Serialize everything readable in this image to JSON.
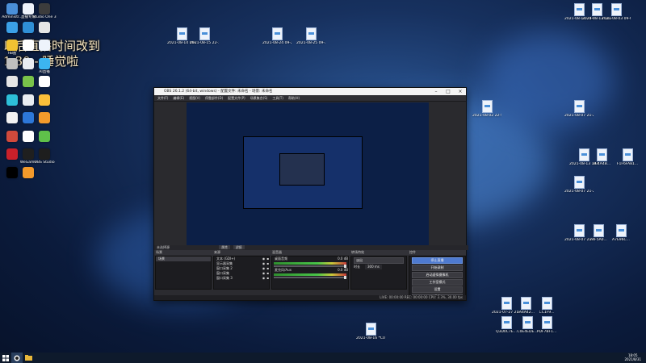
{
  "overlay": {
    "line1": "以后直播时间改到",
    "line2": "1:30 - 睡觉啦"
  },
  "desktop_icons_left": [
    {
      "label": "Administr...",
      "color": "#4a8fd8"
    },
    {
      "label": "直播专用",
      "color": "#eef3fb"
    },
    {
      "label": "Studio One 3",
      "color": "#3c3c3c"
    },
    {
      "label": "",
      "color": "#3ba0e6"
    },
    {
      "label": "",
      "color": "#2f8fd6"
    },
    {
      "label": "",
      "color": "#e6e6e6"
    },
    {
      "label": "HB图",
      "color": "#f1c232"
    },
    {
      "label": "",
      "color": "#ffffff"
    },
    {
      "label": "",
      "color": "#eef3fb"
    },
    {
      "label": "",
      "color": "#bfbfbf"
    },
    {
      "label": "",
      "color": "#e8ecf2"
    },
    {
      "label": "AI直播",
      "color": "#3cb4f0"
    },
    {
      "label": "",
      "color": "#e6e6e6"
    },
    {
      "label": "",
      "color": "#79c34a"
    },
    {
      "label": "",
      "color": "#ffffff"
    },
    {
      "label": "",
      "color": "#2dbfd8"
    },
    {
      "label": "",
      "color": "#e8ecf2"
    },
    {
      "label": "",
      "color": "#fbbf3a"
    },
    {
      "label": "",
      "color": "#f2f2f2"
    },
    {
      "label": "",
      "color": "#2d77d8"
    },
    {
      "label": "",
      "color": "#f39a2b"
    },
    {
      "label": "",
      "color": "#d14a3c"
    },
    {
      "label": "",
      "color": "#ffffff"
    },
    {
      "label": "",
      "color": "#5fc14a"
    },
    {
      "label": "",
      "color": "#c8202a"
    },
    {
      "label": "WeGame",
      "color": "#1f1f1f"
    },
    {
      "label": "OBS Studio",
      "color": "#1e1e1e"
    },
    {
      "label": "",
      "color": "#000000"
    },
    {
      "label": "",
      "color": "#f39a2b"
    }
  ],
  "desktop_icons_right": [
    {
      "label": "2021-08-13 20-02-52..."
    },
    {
      "label": "2021-08-13 14-28-20..."
    },
    {
      "label": "2021-08-03 09-03-11..."
    },
    {
      "label": "2021-08-14 09-29-18..."
    },
    {
      "label": "2021-08-15 22-12-19..."
    },
    {
      "label": "2021-08-24 09-29-31..."
    },
    {
      "label": "2021-08-25 09-30-..."
    },
    {
      "label": "2021-08-02 22-50-20..."
    },
    {
      "label": "2021-08-07 21-28-20..."
    },
    {
      "label": "2021-08-13 19-01-06..."
    },
    {
      "label": "3C4A4B..."
    },
    {
      "label": "F1F6FA81..."
    },
    {
      "label": "2021-08-07 21-29-42..."
    },
    {
      "label": "2021-08-07 21-31-23..."
    },
    {
      "label": "2AF5A0..."
    },
    {
      "label": "A7E96C..."
    },
    {
      "label": "2021-07-27 21-14-18..."
    },
    {
      "label": "1A4A42..."
    },
    {
      "label": "CC1F9..."
    },
    {
      "label": "Q3D0C7E..."
    },
    {
      "label": "C0E4EDE..."
    },
    {
      "label": "PDF7BF1..."
    },
    {
      "label": "2021-08-16 *C0E0C7E..."
    }
  ],
  "obs": {
    "title": "OBS 26.1.2 (64-bit, windows) - 配置文件: 未命名 - 场景: 未命名",
    "menu": [
      "文件(F)",
      "编辑(E)",
      "视图(V)",
      "停靠部件(D)",
      "配置文件(P)",
      "场景集合(S)",
      "工具(T)",
      "帮助(H)"
    ],
    "toolbar_label": "未选择源",
    "properties_label": "属性",
    "filters_label": "滤镜",
    "dock_titles": [
      "场景",
      "来源",
      "混音器",
      "转场特效",
      "控件"
    ],
    "scene": "场景",
    "sources": [
      "文本 (GDI+)",
      "显示器采集",
      "窗口采集 2",
      "窗口采集",
      "窗口采集 3"
    ],
    "mixer": [
      {
        "name": "桌面音频",
        "db": "0.0 dB"
      },
      {
        "name": "麦克风/Aux",
        "db": "0.0 dB"
      }
    ],
    "transition": {
      "type": "淡出",
      "duration_label": "时长",
      "duration": "300 ms"
    },
    "controls": [
      "停止直播",
      "开始录制",
      "启动虚拟摄像机",
      "工作室模式",
      "设置",
      "退出"
    ],
    "status": "LIVE: 00:00:00   REC: 00:00:00   CPU: 3.3%, 30.00 fps"
  },
  "taskbar": {
    "time": "18:05",
    "date": "2021/8/31"
  }
}
